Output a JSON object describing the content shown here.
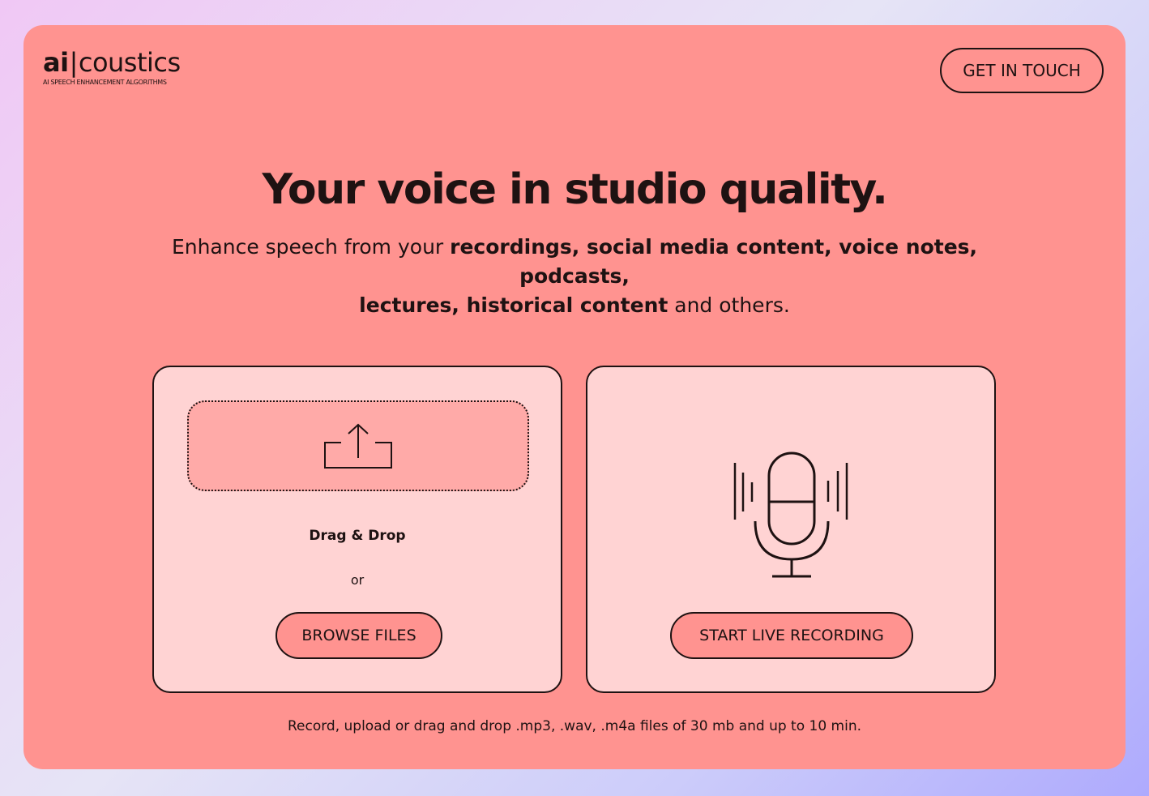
{
  "brand": {
    "logo_ai": "ai",
    "logo_bar": "|",
    "logo_rest": "coustics",
    "tagline": "AI SPEECH ENHANCEMENT ALGORITHMS"
  },
  "header": {
    "contact_label": "GET IN TOUCH"
  },
  "hero": {
    "title": "Your voice in studio quality.",
    "intro": "Enhance speech from your ",
    "uses_line1": "recordings, social media content, voice notes, podcasts,",
    "uses_line2": "lectures, historical content",
    "outro": " and others."
  },
  "upload": {
    "icon": "upload-icon",
    "drag_label": "Drag & Drop",
    "or_label": "or",
    "browse_label": "BROWSE FILES"
  },
  "record": {
    "icon": "microphone-icon",
    "start_label": "START LIVE RECORDING"
  },
  "footer": {
    "note": "Record, upload or drag and drop .mp3, .wav, .m4a files of 30 mb and up to 10 min."
  },
  "colors": {
    "page_gradient_start": "#f0c8f5",
    "page_gradient_end": "#aeaafd",
    "card": "#ff9390",
    "panel": "#ffd3d3",
    "dropzone": "#ffaaa8",
    "ink": "#1e1212"
  }
}
